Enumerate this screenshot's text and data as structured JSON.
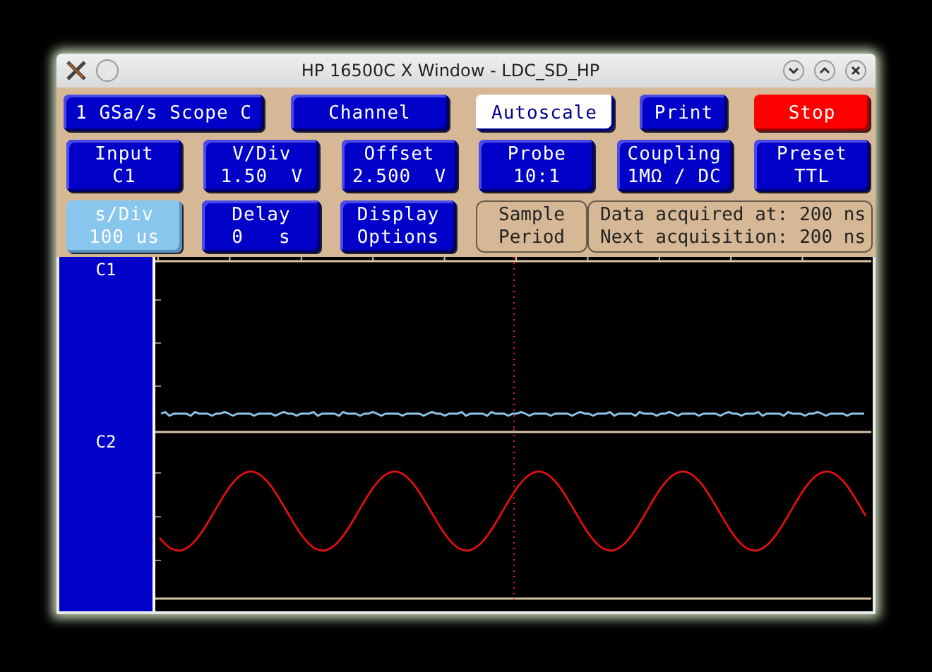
{
  "window": {
    "title": "HP 16500C X Window - LDC_SD_HP"
  },
  "top_buttons": [
    {
      "label": "1 GSa/s Scope C",
      "kind": "normal"
    },
    {
      "label": "Channel",
      "kind": "normal"
    },
    {
      "label": "Autoscale",
      "kind": "highlight"
    },
    {
      "label": "Print",
      "kind": "normal"
    },
    {
      "label": "Stop",
      "kind": "alert"
    }
  ],
  "settings": [
    {
      "label": "Input",
      "value": "C1",
      "kind": "normal"
    },
    {
      "label": "V/Div",
      "value": "1.50  V",
      "kind": "normal"
    },
    {
      "label": "Offset",
      "value": "2.500  V",
      "kind": "normal"
    },
    {
      "label": "Probe",
      "value": "10:1",
      "kind": "normal"
    },
    {
      "label": "Coupling",
      "value": "1MΩ / DC",
      "kind": "normal"
    },
    {
      "label": "Preset",
      "value": "TTL",
      "kind": "normal"
    }
  ],
  "timebase": [
    {
      "label": "s/Div",
      "value": "100 us",
      "kind": "active"
    },
    {
      "label": "Delay",
      "value": "0   s",
      "kind": "normal"
    },
    {
      "label": "Display",
      "value": "Options",
      "kind": "normal"
    }
  ],
  "sample_period": {
    "label": "Sample",
    "value": "Period"
  },
  "acquisition": [
    {
      "label": "Data acquired at:",
      "value": "200 ns"
    },
    {
      "label": "Next acquisition:",
      "value": "200 ns"
    }
  ],
  "channels": [
    {
      "label": "C1",
      "color": "#8ec6ee",
      "kind": "flat"
    },
    {
      "label": "C2",
      "color": "#e01010",
      "kind": "sine"
    }
  ]
}
